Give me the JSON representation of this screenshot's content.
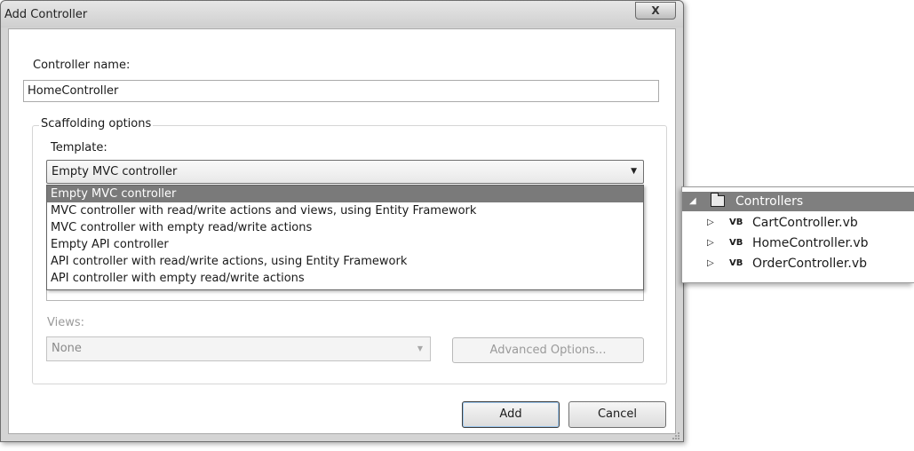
{
  "dialog": {
    "title": "Add Controller",
    "close_glyph": "X",
    "controller_name_label": "Controller name:",
    "controller_name_value": "HomeController",
    "scaffolding_legend": "Scaffolding options",
    "template_label": "Template:",
    "template_selected": "Empty MVC controller",
    "template_options": [
      "Empty MVC controller",
      "MVC controller with read/write actions and views, using Entity Framework",
      "MVC controller with empty read/write actions",
      "Empty API controller",
      "API controller with read/write actions, using Entity Framework",
      "API controller with empty read/write actions"
    ],
    "views_label": "Views:",
    "views_selected": "None",
    "advanced_options_label": "Advanced Options...",
    "add_label": "Add",
    "cancel_label": "Cancel"
  },
  "explorer": {
    "folder_name": "Controllers",
    "files": [
      {
        "badge": "VB",
        "name": "CartController.vb"
      },
      {
        "badge": "VB",
        "name": "HomeController.vb"
      },
      {
        "badge": "VB",
        "name": "OrderController.vb"
      }
    ]
  },
  "colors": {
    "selected_item_bg": "#7a7a7a",
    "dialog_frame": "#d4d4d4",
    "disabled_text": "#9a9a9a"
  }
}
